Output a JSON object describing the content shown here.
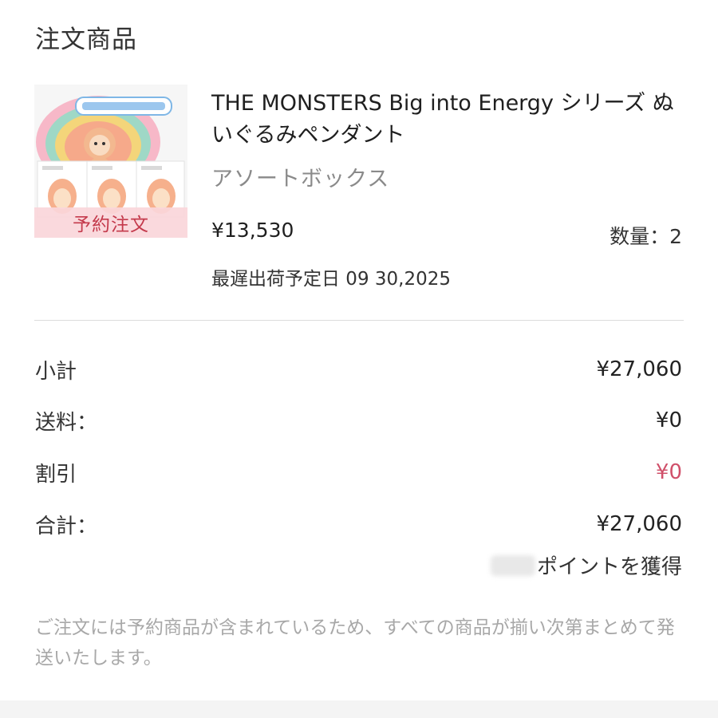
{
  "section": {
    "title": "注文商品"
  },
  "product": {
    "name": "THE MONSTERS Big into Energy シリーズ ぬいぐるみペンダント",
    "variant": "アソートボックス",
    "price": "¥13,530",
    "quantity_label": "数量：2",
    "ship_date": "最遅出荷予定日 09 30,2025",
    "badge": "予約注文",
    "image_icon": "product-box-image"
  },
  "summary": {
    "subtotal_label": "小計",
    "subtotal_value": "¥27,060",
    "shipping_label": "送料：",
    "shipping_value": "¥0",
    "discount_label": "割引",
    "discount_value": "¥0",
    "total_label": "合計：",
    "total_value": "¥27,060",
    "points_text": "ポイントを獲得"
  },
  "notice": "ご注文には予約商品が含まれているため、すべての商品が揃い次第まとめて発送いたします。",
  "colors": {
    "discount": "#d0506a",
    "badge_bg": "#fad6da",
    "badge_text": "#c43a4c",
    "muted": "#a8a8a8"
  }
}
